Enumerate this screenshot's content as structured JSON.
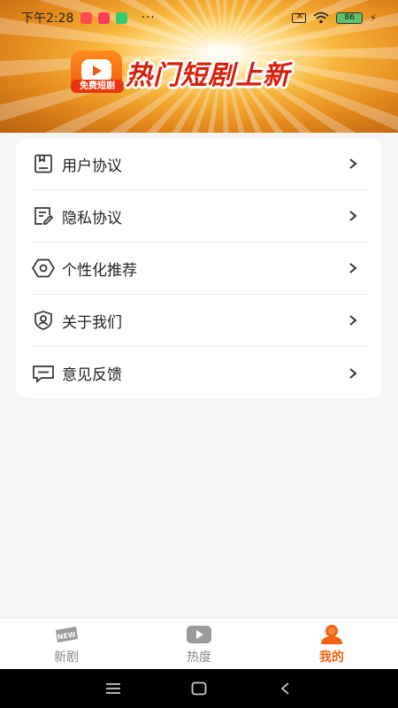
{
  "status_bar": {
    "time": "下午2:28",
    "dots": "···",
    "battery": "86",
    "app_colors": [
      "#ff4d4f",
      "#ff3b58",
      "#2ecc71"
    ]
  },
  "banner": {
    "logo_tag": "免费短剧",
    "slogan": "热门短剧上新"
  },
  "menu": {
    "items": [
      {
        "label": "用户协议",
        "icon": "document-icon"
      },
      {
        "label": "隐私协议",
        "icon": "edit-document-icon"
      },
      {
        "label": "个性化推荐",
        "icon": "gear-icon"
      },
      {
        "label": "关于我们",
        "icon": "user-shield-icon"
      },
      {
        "label": "意见反馈",
        "icon": "message-icon"
      }
    ]
  },
  "bottom_nav": {
    "items": [
      {
        "label": "新剧",
        "icon": "new-badge-icon"
      },
      {
        "label": "热度",
        "icon": "video-play-icon"
      },
      {
        "label": "我的",
        "icon": "profile-icon",
        "active": true
      }
    ],
    "accent": "#f2610f"
  }
}
